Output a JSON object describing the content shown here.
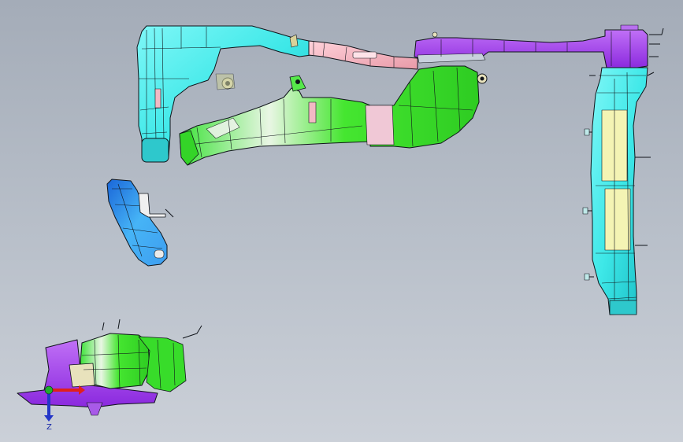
{
  "viewport": {
    "background_top": "#a4acb8",
    "background_bottom": "#cbd0d8"
  },
  "triad": {
    "axis_label": "Z",
    "x_color": "#e0201c",
    "y_color": "#1fae2f",
    "z_color": "#2436c8"
  },
  "colors": {
    "cyan": "#3ee8e8",
    "green": "#36e62a",
    "purple": "#a53cf0",
    "pink": "#f2b9c4",
    "blue": "#2a8ef0",
    "yellow": "#f4f4b4",
    "edge": "#10141a"
  },
  "icons": [
    "axis-triad-icon",
    "origin-sphere-icon"
  ]
}
